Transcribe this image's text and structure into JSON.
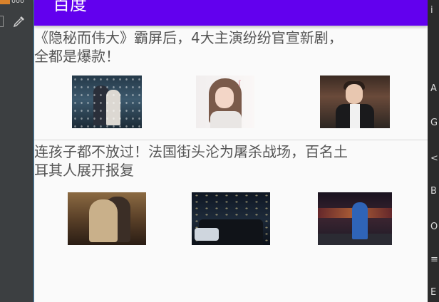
{
  "ide": {
    "tab_text": "ooo",
    "left_icons": [
      "doc-icon",
      "eyedropper-icon"
    ],
    "right_glyphs": [
      "i",
      "A",
      "G",
      "<",
      "B",
      "O",
      "≡",
      "E"
    ]
  },
  "app": {
    "toolbar": {
      "title": "百度",
      "color": "#6200ee"
    },
    "news": [
      {
        "title": "《隐秘而伟大》霸屏后，4大主演纷纷官宣新剧，全都是爆款！",
        "images": [
          "drama-couple-snow-image",
          "actress-portrait-image",
          "actor-portrait-image"
        ]
      },
      {
        "title": "连孩子都不放过！法国街头沦为屠杀战场，百名土耳其人展开报复",
        "images": [
          "hugging-people-image",
          "night-street-crowd-image",
          "police-officer-night-image"
        ]
      }
    ]
  }
}
